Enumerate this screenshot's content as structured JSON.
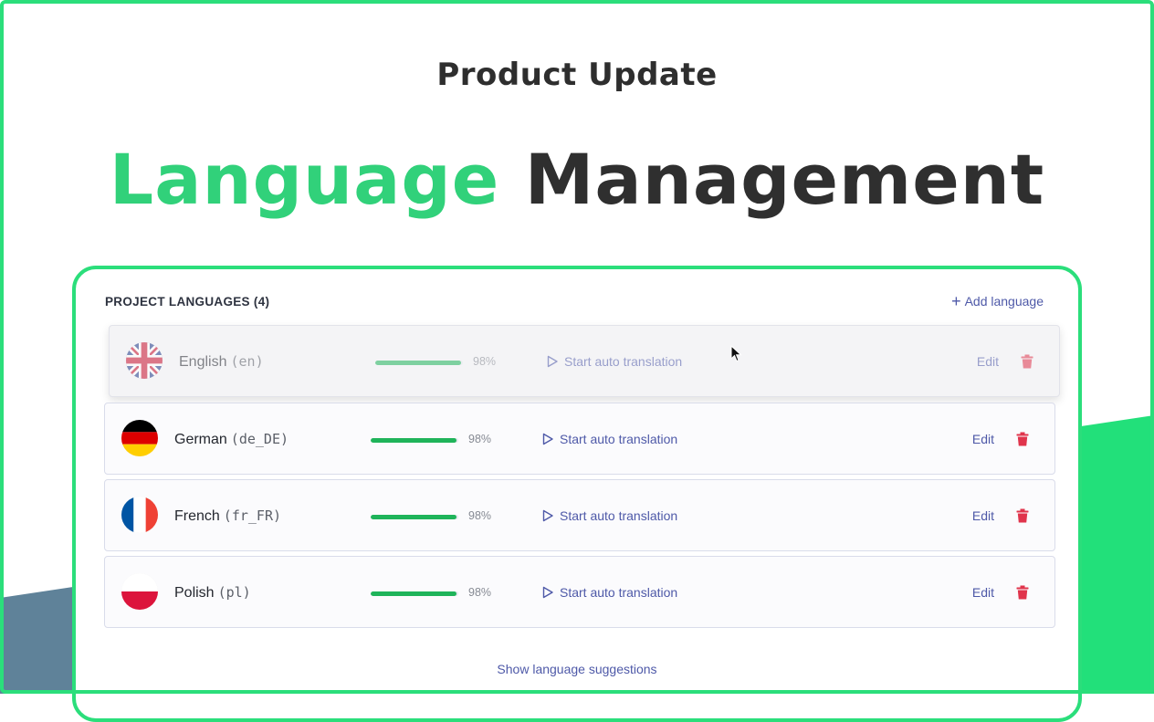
{
  "header": {
    "eyebrow": "Product Update",
    "headline_accent": "Language",
    "headline_rest": "Management"
  },
  "colors": {
    "accent_green": "#31d17a",
    "frame_green": "#2bde7b",
    "link_blue": "#4e59a8",
    "progress_green": "#1fb45a",
    "delete_red": "#e0344c"
  },
  "panel": {
    "title": "PROJECT LANGUAGES (4)",
    "add_label": "Add language",
    "add_icon": "plus-icon",
    "suggestions_label": "Show language suggestions"
  },
  "languages": [
    {
      "name": "English",
      "code": "(en)",
      "flag": "uk-flag-icon",
      "progress": 98,
      "percent_label": "98%",
      "action_label": "Start auto translation",
      "edit_label": "Edit",
      "delete_icon": "trash-icon"
    },
    {
      "name": "German",
      "code": "(de_DE)",
      "flag": "germany-flag-icon",
      "progress": 98,
      "percent_label": "98%",
      "action_label": "Start auto translation",
      "edit_label": "Edit",
      "delete_icon": "trash-icon"
    },
    {
      "name": "French",
      "code": "(fr_FR)",
      "flag": "france-flag-icon",
      "progress": 98,
      "percent_label": "98%",
      "action_label": "Start auto translation",
      "edit_label": "Edit",
      "delete_icon": "trash-icon"
    },
    {
      "name": "Polish",
      "code": "(pl)",
      "flag": "poland-flag-icon",
      "progress": 98,
      "percent_label": "98%",
      "action_label": "Start auto translation",
      "edit_label": "Edit",
      "delete_icon": "trash-icon"
    }
  ]
}
